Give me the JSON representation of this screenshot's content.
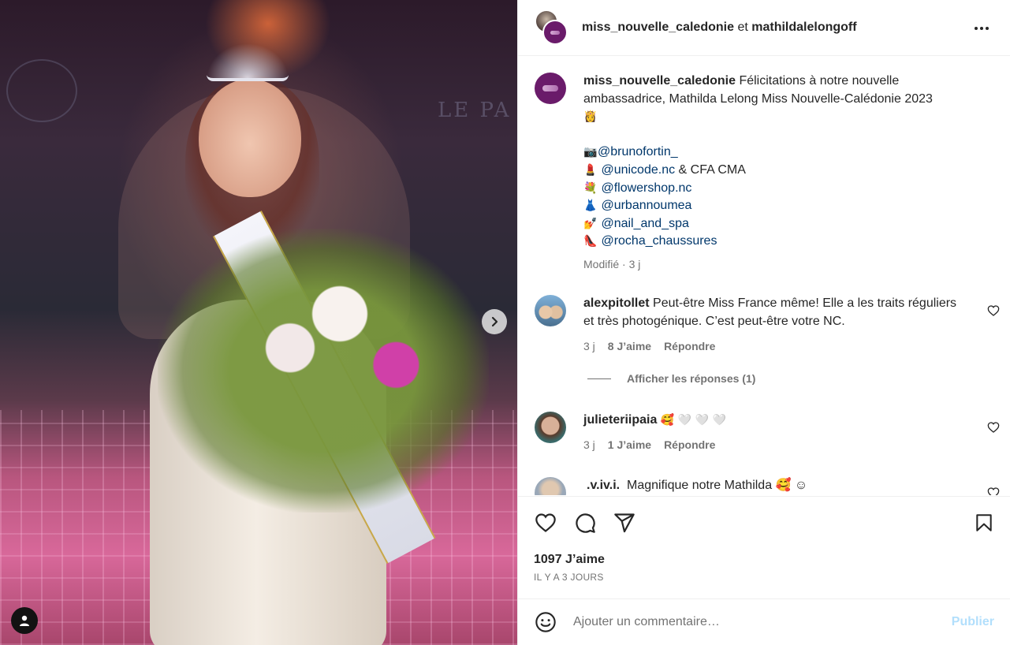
{
  "post_image": {
    "alt_brand_left": "",
    "alt_brand_right": "LE PA"
  },
  "header": {
    "author": "miss_nouvelle_caledonie",
    "connector": "et",
    "coauthor": "mathildalelongoff"
  },
  "caption": {
    "user": "miss_nouvelle_caledonie",
    "text": "Félicitations à notre nouvelle ambassadrice, Mathilda Lelong Miss Nouvelle-Calédonie 2023",
    "crown_emoji": "👸",
    "credits": [
      {
        "emoji": "📷",
        "mention": "@brunofortin_",
        "suffix": ""
      },
      {
        "emoji": "💄",
        "mention": "@unicode.nc",
        "suffix": " & CFA CMA"
      },
      {
        "emoji": "💐",
        "mention": "@flowershop.nc",
        "suffix": ""
      },
      {
        "emoji": "👗",
        "mention": "@urbannoumea",
        "suffix": ""
      },
      {
        "emoji": "💅",
        "mention": "@nail_and_spa",
        "suffix": ""
      },
      {
        "emoji": "👠",
        "mention": "@rocha_chaussures",
        "suffix": ""
      }
    ],
    "edited": "Modifié",
    "time": "3 j"
  },
  "comments": [
    {
      "user": "alexpitollet",
      "text": "Peut-être Miss France même! Elle a les traits réguliers et très photogénique. C’est peut-être votre NC.",
      "time": "3 j",
      "likes": "8 J’aime",
      "reply": "Répondre"
    },
    {
      "user": "julieteriipaia",
      "text": "🥰 🤍 🤍 🤍",
      "time": "3 j",
      "likes": "1 J’aime",
      "reply": "Répondre"
    },
    {
      "user": ".v.iv.i.",
      "text": "Magnifique notre Mathilda 🥰 ☺"
    }
  ],
  "view_replies": "Afficher les réponses (1)",
  "likes_count": "1097 J’aime",
  "posted_ago": "IL Y A 3 JOURS",
  "comment_input": {
    "placeholder": "Ajouter un commentaire…",
    "publish_label": "Publier"
  },
  "colors": {
    "text": "#262626",
    "secondary": "#737373",
    "mention": "#00376b",
    "publish_disabled": "#b2dffc",
    "brand_purple": "#6a1b6a"
  }
}
